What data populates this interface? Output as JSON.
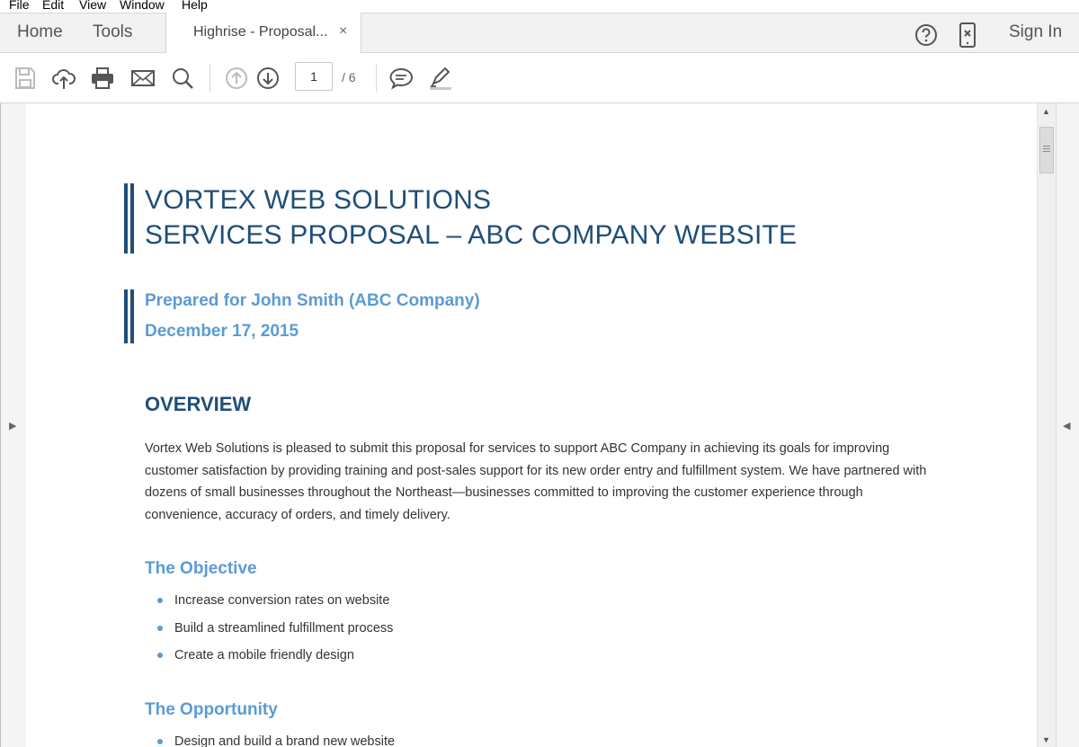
{
  "menu": [
    "File",
    "Edit",
    "View",
    "Window",
    "Help"
  ],
  "tabs": {
    "home": "Home",
    "tools": "Tools",
    "document": "Highrise - Proposal...",
    "close": "×"
  },
  "header": {
    "sign_in": "Sign In"
  },
  "toolbar": {
    "page_current": "1",
    "page_total": "/ 6"
  },
  "colors": {
    "title": "#1f4e79",
    "accent": "#5b9bd5"
  },
  "document": {
    "title_line1": "VORTEX WEB SOLUTIONS",
    "title_line2": "SERVICES PROPOSAL – ABC COMPANY WEBSITE",
    "prepared_for": "Prepared for John Smith (ABC Company)",
    "date": "December 17, 2015",
    "overview_heading": "OVERVIEW",
    "overview_text": "Vortex Web Solutions is pleased to submit this proposal for services to support ABC Company in achieving its goals for improving customer satisfaction by providing training and post-sales support for its new order entry and fulfillment system. We have partnered with dozens of small businesses throughout the Northeast—businesses committed to improving the customer experience through convenience, accuracy of orders, and timely delivery.",
    "objective_heading": "The Objective",
    "objective_items": [
      "Increase conversion rates on website",
      "Build a streamlined fulfillment process",
      "Create a mobile friendly design"
    ],
    "opportunity_heading": "The Opportunity",
    "opportunity_items": [
      "Design and build a brand new website"
    ]
  }
}
